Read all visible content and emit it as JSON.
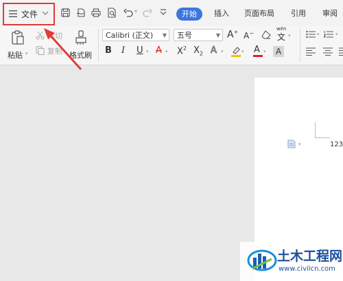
{
  "menubar": {
    "file_label": "文件",
    "tabs": [
      "开始",
      "插入",
      "页面布局",
      "引用",
      "审阅"
    ]
  },
  "clipboard": {
    "paste_label": "粘贴",
    "cut_label": "剪切",
    "copy_label": "复制",
    "format_painter_label": "格式刷"
  },
  "font": {
    "name": "Calibri (正文)",
    "size": "五号",
    "pinyin_glyph": "wén"
  },
  "document": {
    "text": "123"
  },
  "watermark": {
    "title": "土木工程网",
    "url": "www.civilcn.com"
  },
  "colors": {
    "accent": "#3b76e0",
    "highlight": "#e03a3a",
    "font_color": "#e02020",
    "highlight_color": "#f2c400"
  }
}
